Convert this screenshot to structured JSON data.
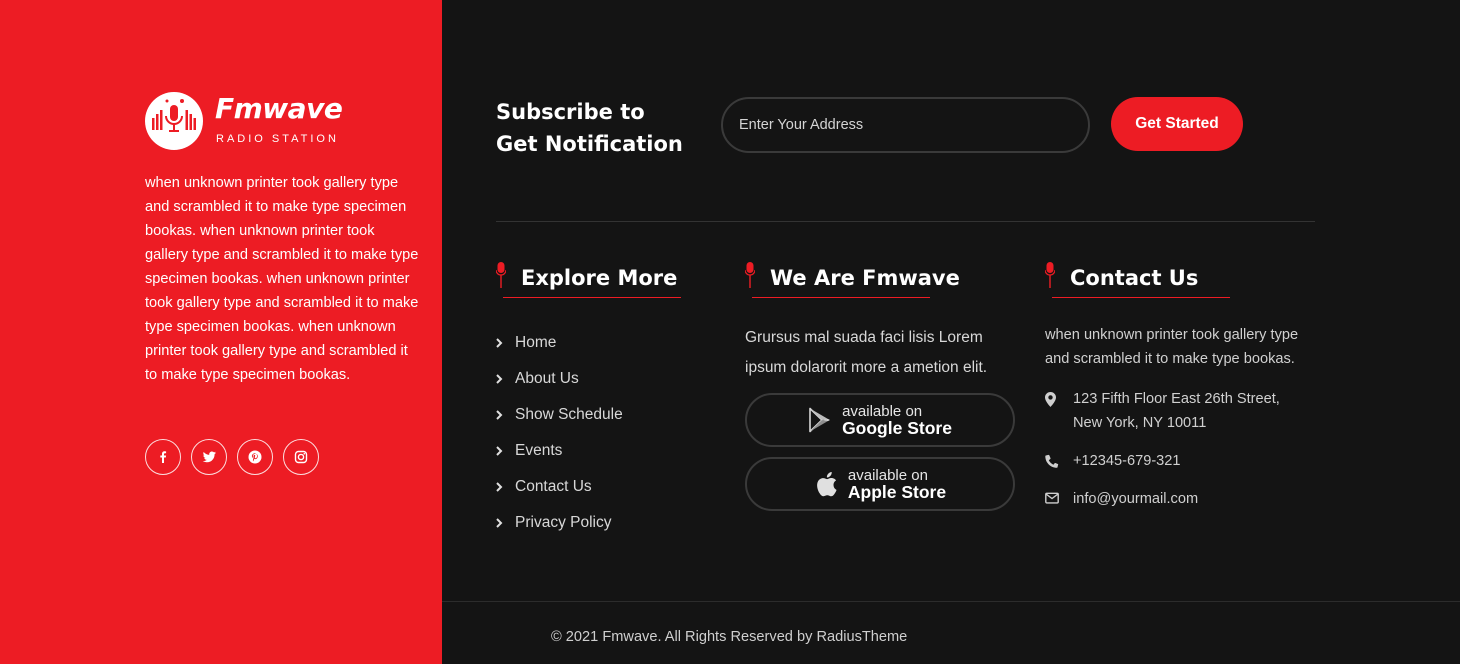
{
  "brand": {
    "name": "Fmwave",
    "tagline": "RADIO STATION",
    "about": "when unknown printer took gallery type and scrambled it to make type specimen bookas. when unknown printer took gallery type and scrambled it to make type specimen bookas. when unknown printer took gallery type and scrambled it to make type specimen bookas. when unknown printer took gallery type and scrambled it to make type specimen bookas."
  },
  "socials": [
    {
      "name": "facebook-icon",
      "glyph": "f"
    },
    {
      "name": "twitter-icon"
    },
    {
      "name": "pinterest-icon"
    },
    {
      "name": "instagram-icon"
    }
  ],
  "subscribe": {
    "title_line1": "Subscribe to",
    "title_line2": "Get Notification",
    "placeholder": "Enter Your Address",
    "button": "Get Started"
  },
  "explore": {
    "heading": "Explore More",
    "links": [
      "Home",
      "About Us",
      "Show Schedule",
      "Events",
      "Contact Us",
      "Privacy Policy"
    ]
  },
  "about_col": {
    "heading": "We Are Fmwave",
    "text": "Grursus mal suada faci lisis Lorem ipsum dolarorit more a ametion elit.",
    "google": {
      "small": "available on",
      "big": "Google Store"
    },
    "apple": {
      "small": "available on",
      "big": "Apple Store"
    }
  },
  "contact": {
    "heading": "Contact Us",
    "text": "when unknown printer took gallery type and scrambled it to make type bookas.",
    "address_line1": "123 Fifth Floor East 26th Street,",
    "address_line2": "New York, NY 10011",
    "phone": "+12345-679-321",
    "email": "info@yourmail.com"
  },
  "footer": {
    "copyright": "© 2021 Fmwave. All Rights Reserved by RadiusTheme"
  },
  "colors": {
    "accent": "#ed1c24",
    "dark": "#141414"
  }
}
